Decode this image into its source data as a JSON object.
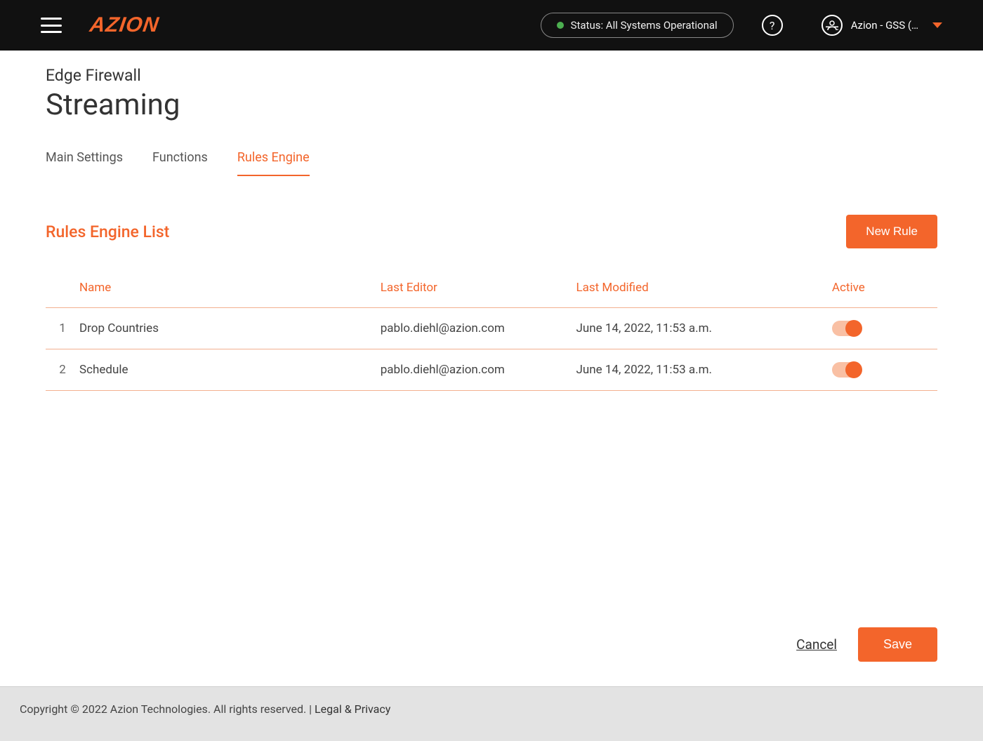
{
  "header": {
    "status_label": "Status: All Systems Operational",
    "user_label": "Azion - GSS (…",
    "logo_text": "AZION"
  },
  "breadcrumb": "Edge Firewall",
  "page_title": "Streaming",
  "tabs": [
    {
      "label": "Main Settings",
      "active": false
    },
    {
      "label": "Functions",
      "active": false
    },
    {
      "label": "Rules Engine",
      "active": true
    }
  ],
  "list": {
    "title": "Rules Engine List",
    "new_button": "New Rule",
    "columns": {
      "name": "Name",
      "last_editor": "Last Editor",
      "last_modified": "Last Modified",
      "active": "Active"
    },
    "rows": [
      {
        "idx": "1",
        "name": "Drop Countries",
        "editor": "pablo.diehl@azion.com",
        "modified": "June 14, 2022, 11:53 a.m.",
        "active": true
      },
      {
        "idx": "2",
        "name": "Schedule",
        "editor": "pablo.diehl@azion.com",
        "modified": "June 14, 2022, 11:53 a.m.",
        "active": true
      }
    ]
  },
  "actions": {
    "cancel": "Cancel",
    "save": "Save"
  },
  "footer": {
    "copyright": "Copyright © 2022 Azion Technologies. All rights reserved.",
    "separator": "  |  ",
    "legal": "Legal & Privacy"
  }
}
